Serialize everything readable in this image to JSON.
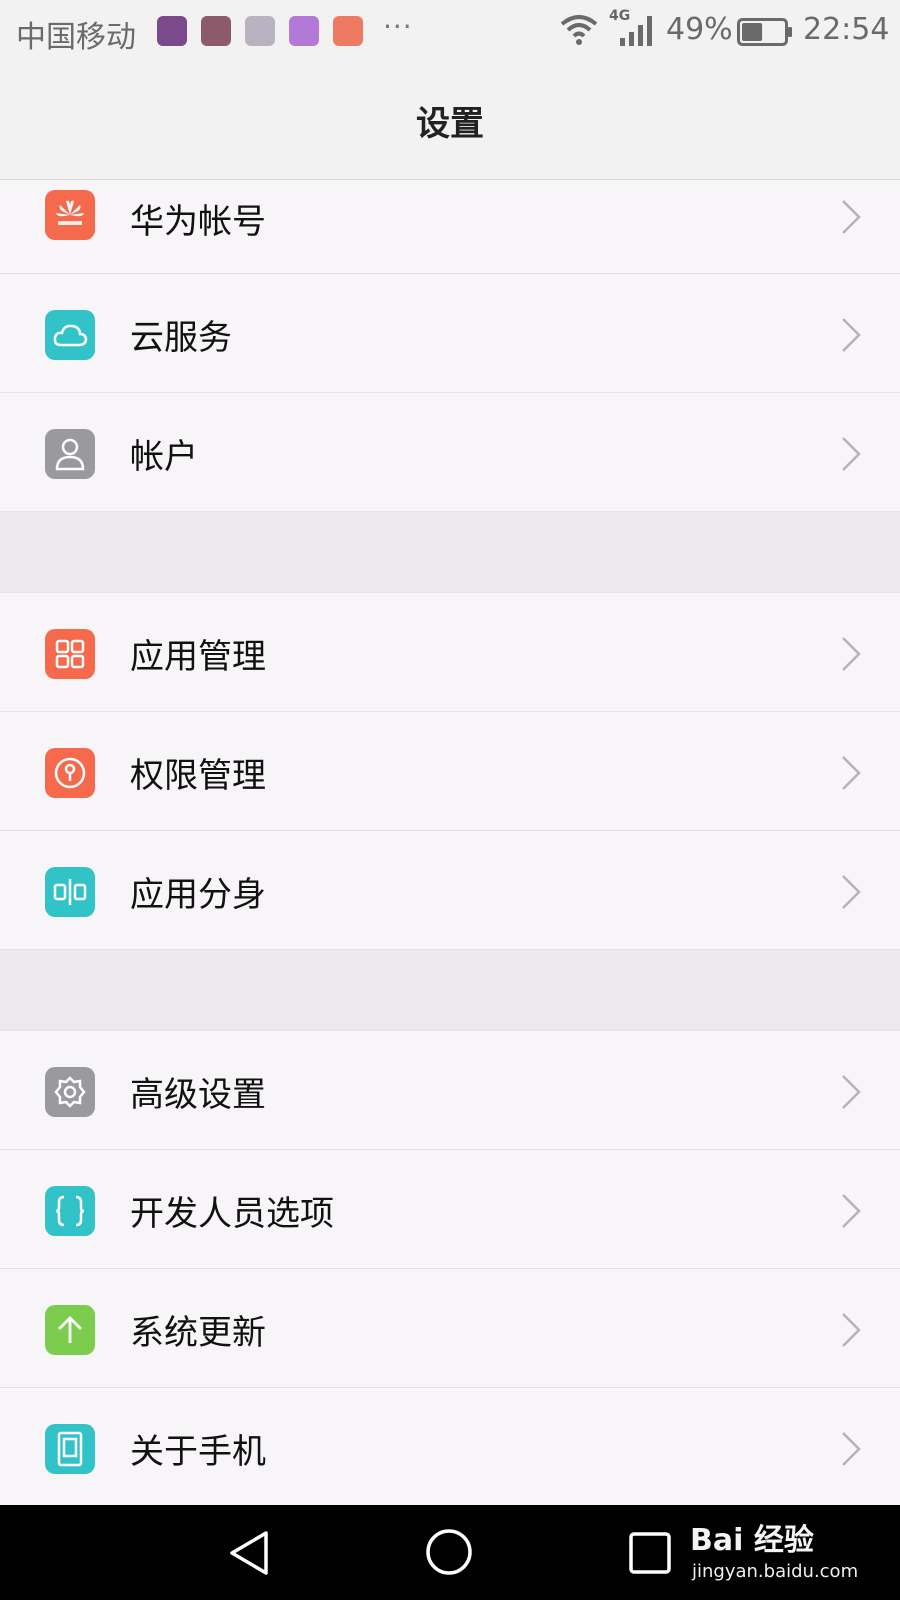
{
  "status_bar": {
    "carrier": "中国移动",
    "overflow": "···",
    "network": "4G",
    "battery_percent": "49%",
    "battery_level": 0.49,
    "time": "22:54"
  },
  "header": {
    "title": "设置"
  },
  "colors": {
    "orange": "#f5694d",
    "teal": "#32c3c9",
    "gray": "#9a9a9e",
    "green": "#7ccd4e"
  },
  "groups": [
    {
      "items": [
        {
          "label": "华为帐号",
          "icon": "huawei-logo-icon",
          "color": "#f5694d"
        },
        {
          "label": "云服务",
          "icon": "cloud-icon",
          "color": "#32c3c9"
        },
        {
          "label": "帐户",
          "icon": "person-icon",
          "color": "#9a9a9e"
        }
      ]
    },
    {
      "items": [
        {
          "label": "应用管理",
          "icon": "apps-grid-icon",
          "color": "#f5694d"
        },
        {
          "label": "权限管理",
          "icon": "keyhole-icon",
          "color": "#f5694d"
        },
        {
          "label": "应用分身",
          "icon": "app-twin-icon",
          "color": "#32c3c9"
        }
      ]
    },
    {
      "items": [
        {
          "label": "高级设置",
          "icon": "gear-icon",
          "color": "#9a9a9e"
        },
        {
          "label": "开发人员选项",
          "icon": "braces-icon",
          "color": "#32c3c9"
        },
        {
          "label": "系统更新",
          "icon": "arrow-up-icon",
          "color": "#7ccd4e"
        },
        {
          "label": "关于手机",
          "icon": "phone-icon",
          "color": "#32c3c9"
        }
      ]
    }
  ],
  "watermark": {
    "logo": "Bai 经验",
    "url": "jingyan.baidu.com"
  }
}
